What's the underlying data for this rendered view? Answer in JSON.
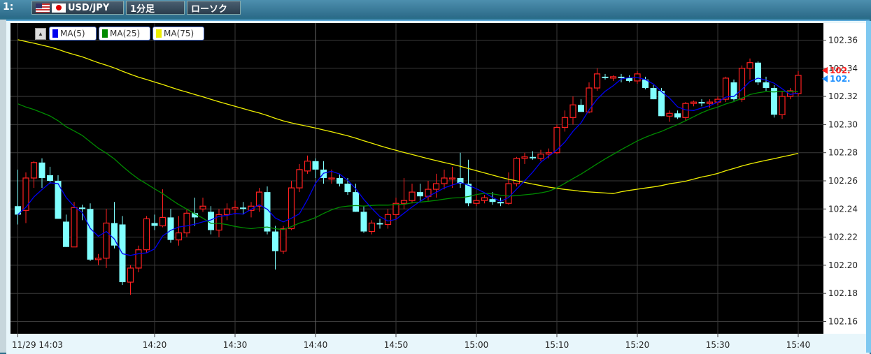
{
  "toolbar": {
    "panel_number": "1:",
    "pair": "USD/JPY",
    "timeframe": "1分足",
    "chart_style": "ローソク"
  },
  "legend": [
    {
      "label": "MA(5)",
      "color": "#0000ee"
    },
    {
      "label": "MA(25)",
      "color": "#008a00"
    },
    {
      "label": "MA(75)",
      "color": "#eeee00"
    }
  ],
  "price_markers": [
    {
      "label": "102.",
      "color": "#ff2020",
      "value": 102.3385
    },
    {
      "label": "102.",
      "color": "#1e90ff",
      "value": 102.3325
    }
  ],
  "chart_data": {
    "type": "candlestick",
    "title": "",
    "xlabel": "",
    "ylabel": "",
    "ylim": [
      102.15,
      102.37
    ],
    "yticks": [
      102.16,
      102.18,
      102.2,
      102.22,
      102.24,
      102.26,
      102.28,
      102.3,
      102.32,
      102.34,
      102.36
    ],
    "ytick_labels": [
      "102.16",
      "102.18",
      "102.20",
      "102.22",
      "102.24",
      "102.26",
      "102.28",
      "102.30",
      "102.32",
      "102.34",
      "102.36"
    ],
    "x_start_minute": 0,
    "x_end_minute": 99,
    "xticks": [
      {
        "label": "11/29 14:03",
        "minute": 0
      },
      {
        "label": "14:20",
        "minute": 17
      },
      {
        "label": "14:30",
        "minute": 27
      },
      {
        "label": "14:40",
        "minute": 37
      },
      {
        "label": "14:50",
        "minute": 47
      },
      {
        "label": "15:00",
        "minute": 57
      },
      {
        "label": "15:10",
        "minute": 67
      },
      {
        "label": "15:20",
        "minute": 77
      },
      {
        "label": "15:30",
        "minute": 87
      },
      {
        "label": "15:40",
        "minute": 97
      }
    ],
    "grid": true,
    "up_color": "#ff2020",
    "down_color": "#80ffff",
    "candles": [
      [
        102.242,
        102.268,
        102.229,
        102.236
      ],
      [
        102.239,
        102.266,
        102.23,
        102.262
      ],
      [
        102.262,
        102.274,
        102.255,
        102.273
      ],
      [
        102.273,
        102.276,
        102.255,
        102.262
      ],
      [
        102.264,
        102.27,
        102.258,
        102.26
      ],
      [
        102.26,
        102.264,
        102.235,
        102.233
      ],
      [
        102.231,
        102.236,
        102.213,
        102.213
      ],
      [
        102.213,
        102.245,
        102.213,
        102.241
      ],
      [
        102.241,
        102.243,
        102.232,
        102.24
      ],
      [
        102.24,
        102.244,
        102.203,
        102.204
      ],
      [
        102.204,
        102.208,
        102.2,
        102.205
      ],
      [
        102.205,
        102.24,
        102.198,
        102.23
      ],
      [
        102.23,
        102.245,
        102.212,
        102.214
      ],
      [
        102.229,
        102.235,
        102.186,
        102.188
      ],
      [
        102.188,
        102.2,
        102.179,
        102.198
      ],
      [
        102.198,
        102.214,
        102.195,
        102.211
      ],
      [
        102.211,
        102.235,
        102.209,
        102.233
      ],
      [
        102.23,
        102.236,
        102.225,
        102.228
      ],
      [
        102.228,
        102.254,
        102.227,
        102.234
      ],
      [
        102.234,
        102.24,
        102.216,
        102.218
      ],
      [
        102.218,
        102.235,
        102.214,
        102.223
      ],
      [
        102.223,
        102.24,
        102.22,
        102.237
      ],
      [
        102.237,
        102.248,
        102.228,
        102.234
      ],
      [
        102.24,
        102.248,
        102.238,
        102.242
      ],
      [
        102.238,
        102.242,
        102.222,
        102.225
      ],
      [
        102.225,
        102.24,
        102.22,
        102.236
      ],
      [
        102.236,
        102.244,
        102.232,
        102.24
      ],
      [
        102.24,
        102.246,
        102.236,
        102.241
      ],
      [
        102.241,
        102.245,
        102.236,
        102.24
      ],
      [
        102.239,
        102.245,
        102.234,
        102.242
      ],
      [
        102.242,
        102.255,
        102.238,
        102.252
      ],
      [
        102.252,
        102.256,
        102.222,
        102.224
      ],
      [
        102.224,
        102.228,
        102.197,
        102.21
      ],
      [
        102.21,
        102.228,
        102.208,
        102.226
      ],
      [
        102.226,
        102.26,
        102.225,
        102.255
      ],
      [
        102.255,
        102.272,
        102.252,
        102.268
      ],
      [
        102.267,
        102.278,
        102.265,
        102.274
      ],
      [
        102.274,
        102.276,
        102.262,
        102.268
      ],
      [
        102.268,
        102.274,
        102.258,
        102.262
      ],
      [
        102.262,
        102.268,
        102.258,
        102.262
      ],
      [
        102.262,
        102.265,
        102.256,
        102.258
      ],
      [
        102.258,
        102.262,
        102.25,
        102.252
      ],
      [
        102.252,
        102.258,
        102.238,
        102.238
      ],
      [
        102.238,
        102.242,
        102.223,
        102.224
      ],
      [
        102.224,
        102.232,
        102.222,
        102.23
      ],
      [
        102.23,
        102.233,
        102.226,
        102.229
      ],
      [
        102.229,
        102.24,
        102.226,
        102.236
      ],
      [
        102.236,
        102.248,
        102.232,
        102.244
      ],
      [
        102.244,
        102.262,
        102.24,
        102.246
      ],
      [
        102.246,
        102.258,
        102.244,
        102.252
      ],
      [
        102.252,
        102.258,
        102.246,
        102.249
      ],
      [
        102.249,
        102.26,
        102.246,
        102.254
      ],
      [
        102.254,
        102.265,
        102.248,
        102.258
      ],
      [
        102.258,
        102.268,
        102.254,
        102.262
      ],
      [
        102.262,
        102.27,
        102.255,
        102.262
      ],
      [
        102.262,
        102.28,
        102.255,
        102.258
      ],
      [
        102.258,
        102.275,
        102.242,
        102.244
      ],
      [
        102.244,
        102.25,
        102.242,
        102.246
      ],
      [
        102.246,
        102.25,
        102.244,
        102.248
      ],
      [
        102.247,
        102.252,
        102.243,
        102.245
      ],
      [
        102.245,
        102.248,
        102.242,
        102.244
      ],
      [
        102.244,
        102.266,
        102.243,
        102.258
      ],
      [
        102.258,
        102.277,
        102.256,
        102.276
      ],
      [
        102.276,
        102.28,
        102.272,
        102.277
      ],
      [
        102.277,
        102.281,
        102.275,
        102.276
      ],
      [
        102.276,
        102.282,
        102.274,
        102.279
      ],
      [
        102.279,
        102.283,
        102.276,
        102.28
      ],
      [
        102.28,
        102.3,
        102.279,
        102.298
      ],
      [
        102.298,
        102.31,
        102.295,
        102.305
      ],
      [
        102.305,
        102.32,
        102.3,
        102.314
      ],
      [
        102.314,
        102.318,
        102.31,
        102.309
      ],
      [
        102.309,
        102.33,
        102.308,
        102.326
      ],
      [
        102.326,
        102.34,
        102.324,
        102.336
      ],
      [
        102.334,
        102.336,
        102.332,
        102.333
      ],
      [
        102.333,
        102.335,
        102.331,
        102.334
      ],
      [
        102.334,
        102.336,
        102.33,
        102.333
      ],
      [
        102.333,
        102.335,
        102.33,
        102.331
      ],
      [
        102.331,
        102.338,
        102.329,
        102.336
      ],
      [
        102.332,
        102.334,
        102.325,
        102.326
      ],
      [
        102.326,
        102.328,
        102.318,
        102.318
      ],
      [
        102.324,
        102.326,
        102.306,
        102.306
      ],
      [
        102.306,
        102.31,
        102.302,
        102.308
      ],
      [
        102.308,
        102.31,
        102.304,
        102.305
      ],
      [
        102.305,
        102.316,
        102.303,
        102.315
      ],
      [
        102.315,
        102.317,
        102.313,
        102.316
      ],
      [
        102.316,
        102.318,
        102.313,
        102.315
      ],
      [
        102.315,
        102.318,
        102.312,
        102.316
      ],
      [
        102.316,
        102.32,
        102.314,
        102.318
      ],
      [
        102.318,
        102.334,
        102.316,
        102.333
      ],
      [
        102.33,
        102.332,
        102.317,
        102.318
      ],
      [
        102.318,
        102.342,
        102.316,
        102.34
      ],
      [
        102.34,
        102.347,
        102.332,
        102.344
      ],
      [
        102.344,
        102.345,
        102.328,
        102.33
      ],
      [
        102.33,
        102.334,
        102.324,
        102.326
      ],
      [
        102.326,
        102.328,
        102.305,
        102.307
      ],
      [
        102.307,
        102.324,
        102.304,
        102.32
      ],
      [
        102.32,
        102.326,
        102.318,
        102.324
      ],
      [
        102.322,
        102.338,
        102.32,
        102.335
      ]
    ],
    "ma_windows": [
      5,
      25,
      75
    ]
  }
}
